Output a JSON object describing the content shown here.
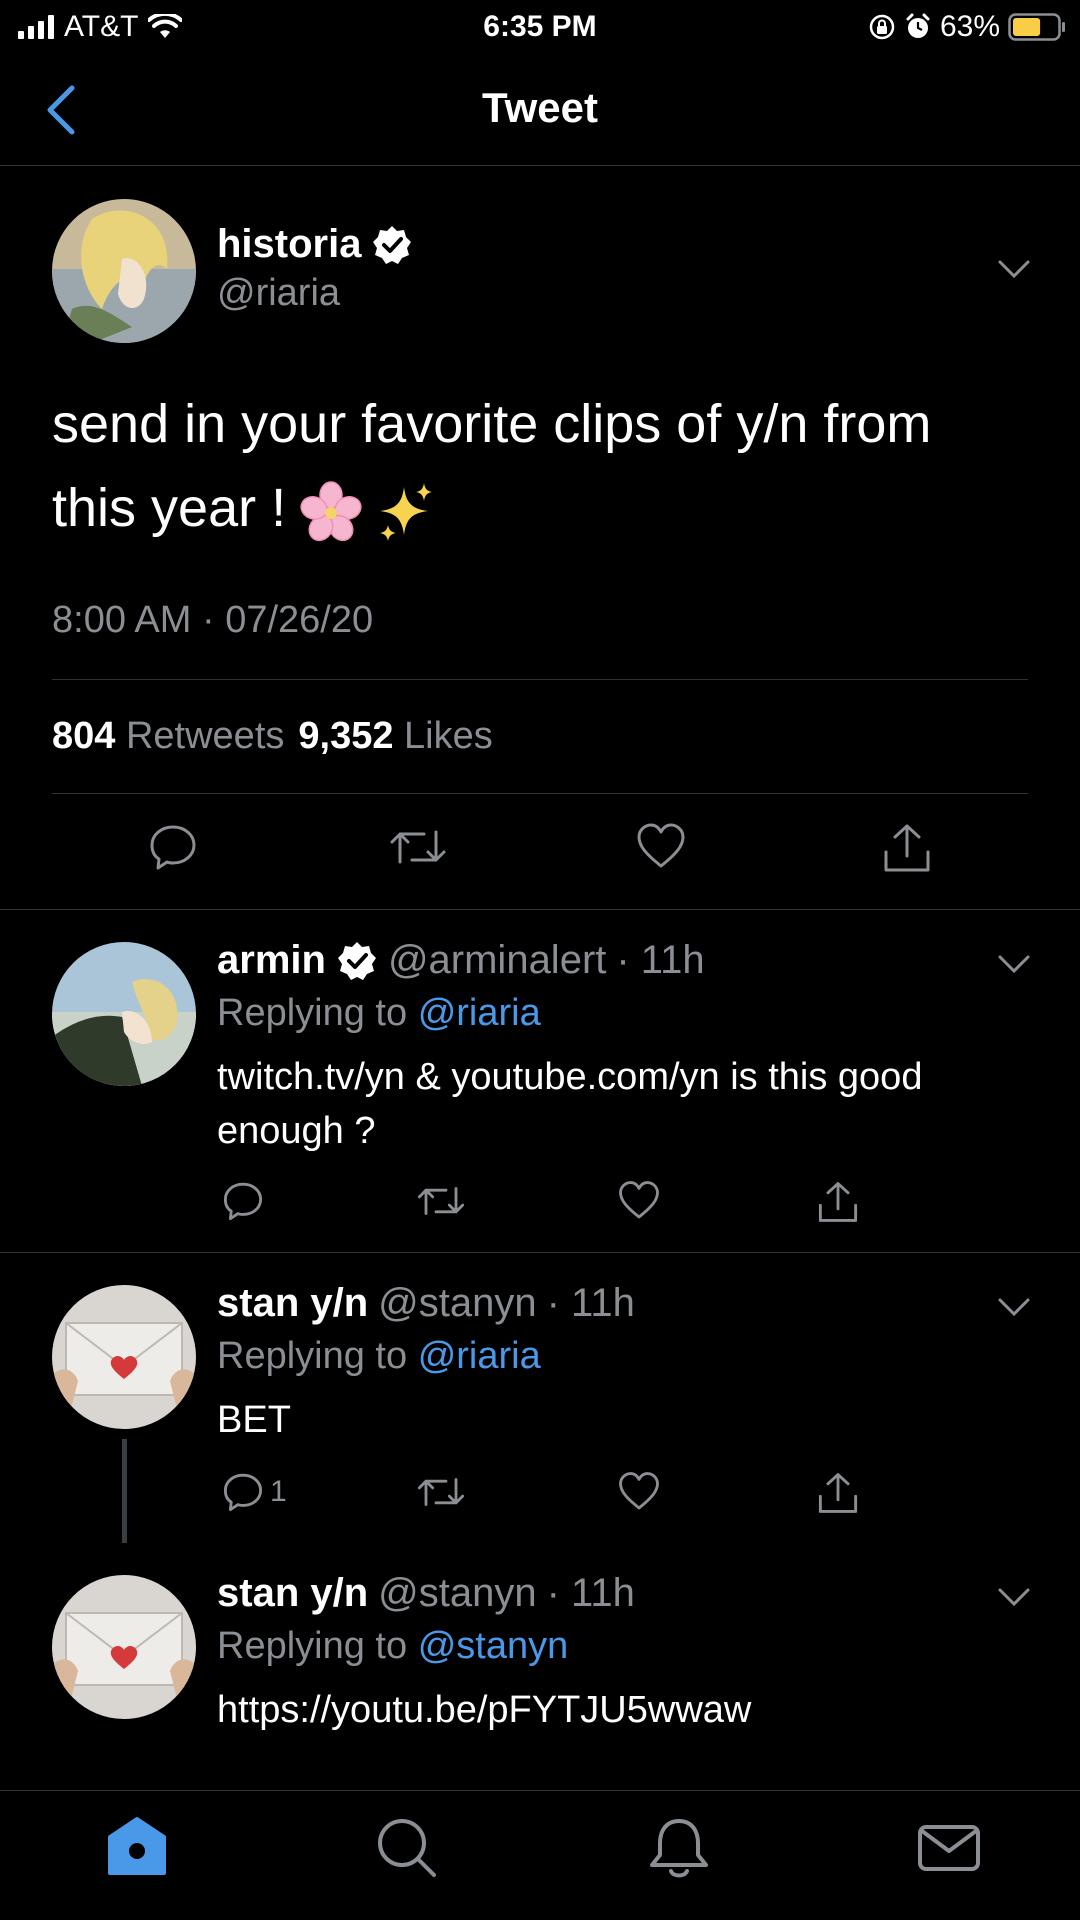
{
  "status_bar": {
    "carrier": "AT&T",
    "time": "6:35 PM",
    "battery": "63%",
    "battery_level": 0.63
  },
  "header": {
    "title": "Tweet"
  },
  "tweet": {
    "display_name": "historia",
    "handle": "@riaria",
    "verified": true,
    "text_line1": "send in your favorite clips of y/n from",
    "text_line2": "this year !",
    "emojis": [
      "cherry-blossom-icon",
      "sparkles-icon"
    ],
    "timestamp": "8:00 AM · 07/26/20",
    "retweets_count": "804",
    "retweets_label": "Retweets",
    "likes_count": "9,352",
    "likes_label": "Likes"
  },
  "replies": [
    {
      "display_name": "armin",
      "verified": true,
      "handle": "@arminalert",
      "age": "· 11h",
      "replying_prefix": "Replying to",
      "replying_to": "@riaria",
      "text_line1": "twitch.tv/yn & youtube.com/yn is this good",
      "text_line2": "enough ?",
      "reply_count": ""
    },
    {
      "display_name": "stan y/n",
      "verified": false,
      "handle": "@stanyn",
      "age": "· 11h",
      "replying_prefix": "Replying to",
      "replying_to": "@riaria",
      "text_line1": "BET",
      "reply_count": "1"
    },
    {
      "display_name": "stan y/n",
      "verified": false,
      "handle": "@stanyn",
      "age": "· 11h",
      "replying_prefix": "Replying to",
      "replying_to": "@stanyn",
      "text_line1": "https://youtu.be/pFYTJU5wwaw"
    }
  ],
  "tabs": [
    "home-icon",
    "search-icon",
    "notifications-icon",
    "messages-icon"
  ],
  "colors": {
    "accent": "#4a99e9",
    "muted": "#8b8f94",
    "divider": "#2f3336",
    "battery": "#f7ce46"
  }
}
